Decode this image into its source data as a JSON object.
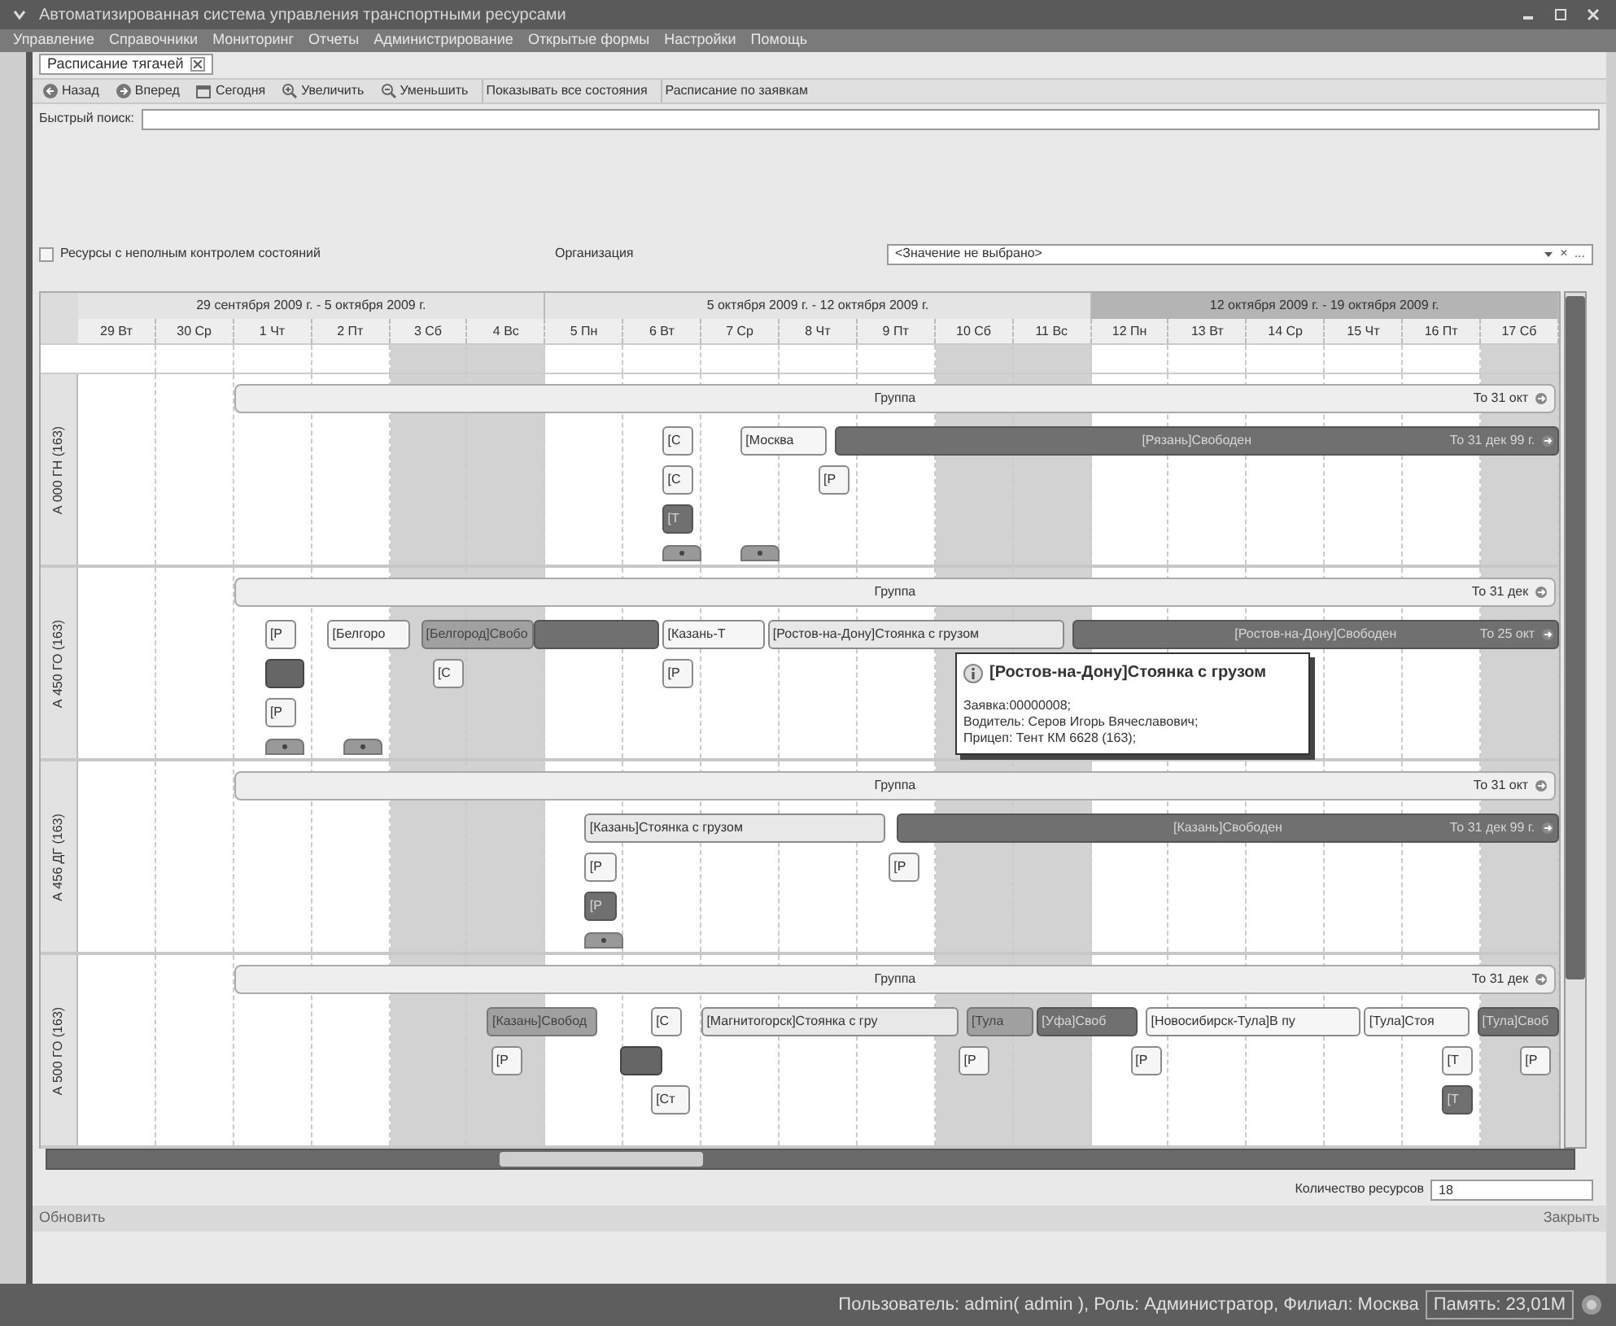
{
  "window": {
    "title": "Автоматизированная система управления транспортными ресурсами"
  },
  "menu": [
    "Управление",
    "Справочники",
    "Мониторинг",
    "Отчеты",
    "Администрирование",
    "Открытые формы",
    "Настройки",
    "Помощь"
  ],
  "tabs": [
    {
      "label": "Расписание тягачей",
      "selected": true
    }
  ],
  "toolbar": [
    {
      "kind": "back",
      "label": "Назад"
    },
    {
      "kind": "forward",
      "label": "Вперед"
    },
    {
      "kind": "today",
      "label": "Сегодня"
    },
    {
      "kind": "zoom_in",
      "label": "Увеличить"
    },
    {
      "kind": "zoom_out",
      "label": "Уменьшить"
    },
    {
      "kind": "text",
      "label": "Показывать все состояния"
    },
    {
      "kind": "text",
      "label": "Расписание по заявкам"
    }
  ],
  "quick_search": {
    "label": "Быстрый поиск:"
  },
  "filters": {
    "checkbox": {
      "label": "Ресурсы с неполным контролем состояний",
      "checked": false
    },
    "organization": {
      "label": "Организация",
      "value": "<Значение не выбрано>",
      "clear": "×",
      "more": "..."
    }
  },
  "schedule": {
    "weeks": [
      {
        "label": "29 сентября 2009 г. - 5 октября 2009 г.",
        "highlighted": false
      },
      {
        "label": "5 октября 2009 г. - 12 октября 2009 г.",
        "highlighted": false
      },
      {
        "label": "12 октября 2009 г. - 19 октября 2009 г.",
        "highlighted": true
      }
    ],
    "days": [
      {
        "label": "29 Вт",
        "weekend": false
      },
      {
        "label": "30 Ср",
        "weekend": false
      },
      {
        "label": "1 Чт",
        "weekend": false
      },
      {
        "label": "2 Пт",
        "weekend": false
      },
      {
        "label": "3 Сб",
        "weekend": true
      },
      {
        "label": "4 Вс",
        "weekend": true
      },
      {
        "label": "5 Пн",
        "weekend": false
      },
      {
        "label": "6 Вт",
        "weekend": false
      },
      {
        "label": "7 Ср",
        "weekend": false
      },
      {
        "label": "8 Чт",
        "weekend": false
      },
      {
        "label": "9 Пт",
        "weekend": false
      },
      {
        "label": "10 Сб",
        "weekend": true
      },
      {
        "label": "11 Вс",
        "weekend": true
      },
      {
        "label": "12 Пн",
        "weekend": false
      },
      {
        "label": "13 Вт",
        "weekend": false
      },
      {
        "label": "14 Ср",
        "weekend": false
      },
      {
        "label": "15 Чт",
        "weekend": false
      },
      {
        "label": "16 Пт",
        "weekend": false
      },
      {
        "label": "17 Сб",
        "weekend": true
      }
    ],
    "resources": [
      {
        "name": "А 000 ГН (163)",
        "group": {
          "label": "Группа",
          "until": "То 31 окт"
        },
        "events": [
          {
            "kind": "chip",
            "label": "[С"
          },
          {
            "kind": "chip",
            "label": "[Москва"
          },
          {
            "kind": "dark",
            "label": "[Рязань]Свободен",
            "until": "То 31 дек 99 г."
          },
          {
            "kind": "chip",
            "label": "[С"
          },
          {
            "kind": "chip",
            "label": "[Р"
          },
          {
            "kind": "dark",
            "label": "[Т"
          },
          {
            "kind": "tab"
          },
          {
            "kind": "tab"
          }
        ]
      },
      {
        "name": "А 450 ГО (163)",
        "group": {
          "label": "Группа",
          "until": "То 31 дек"
        },
        "events": [
          {
            "kind": "chip",
            "label": "[Р"
          },
          {
            "kind": "chip",
            "label": "[Белгоро"
          },
          {
            "kind": "mid",
            "label": "[Белгород]Свобо"
          },
          {
            "kind": "dark"
          },
          {
            "kind": "chip",
            "label": "[Казань-Т"
          },
          {
            "kind": "bar",
            "label": "[Ростов-на-Дону]Стоянка с грузом"
          },
          {
            "kind": "dark",
            "label": "[Ростов-на-Дону]Свободен",
            "until": "То 25 окт"
          },
          {
            "kind": "marker"
          },
          {
            "kind": "chip",
            "label": "[С"
          },
          {
            "kind": "chip",
            "label": "[Р"
          },
          {
            "kind": "chip",
            "label": "[Р"
          },
          {
            "kind": "tab"
          },
          {
            "kind": "tab"
          }
        ]
      },
      {
        "name": "А 456 ДГ (163)",
        "group": {
          "label": "Группа",
          "until": "То 31 окт"
        },
        "events": [
          {
            "kind": "bar",
            "label": "[Казань]Стоянка с грузом"
          },
          {
            "kind": "dark",
            "label": "[Казань]Свободен",
            "until": "То 31 дек 99 г."
          },
          {
            "kind": "chip",
            "label": "[Р"
          },
          {
            "kind": "chip",
            "label": "[Р"
          },
          {
            "kind": "dark",
            "label": "[Р"
          },
          {
            "kind": "tab"
          }
        ]
      },
      {
        "name": "А 500 ГО (163)",
        "group": {
          "label": "Группа",
          "until": "То 31 дек"
        },
        "events": [
          {
            "kind": "mid",
            "label": "[Казань]Свобод"
          },
          {
            "kind": "chip",
            "label": "[С"
          },
          {
            "kind": "bar",
            "label": "[Магнитогорск]Стоянка с гру"
          },
          {
            "kind": "mid",
            "label": "[Тула"
          },
          {
            "kind": "dark",
            "label": "[Уфа]Своб"
          },
          {
            "kind": "chip",
            "label": "[Новосибирск-Тула]В пу"
          },
          {
            "kind": "chip",
            "label": "[Тула]Стоя"
          },
          {
            "kind": "dark",
            "label": "[Тула]Своб"
          },
          {
            "kind": "chip",
            "label": "[Р"
          },
          {
            "kind": "marker"
          },
          {
            "kind": "chip",
            "label": "[Р"
          },
          {
            "kind": "chip",
            "label": "[Р"
          },
          {
            "kind": "chip",
            "label": "[Т"
          },
          {
            "kind": "chip",
            "label": "[Р"
          },
          {
            "kind": "chip",
            "label": "[Ст"
          },
          {
            "kind": "dark",
            "label": "[Т"
          }
        ]
      }
    ]
  },
  "tooltip": {
    "title": "[Ростов-на-Дону]Стоянка с грузом",
    "lines": [
      "Заявка:00000008;",
      "Водитель: Серов Игорь Вячеславович;",
      "Прицеп: Тент КМ 6628 (163);"
    ]
  },
  "resource_count": {
    "label": "Количество ресурсов",
    "value": "18"
  },
  "footer": {
    "refresh": "Обновить",
    "close": "Закрыть"
  },
  "status_bar": {
    "user": "Пользователь: admin( admin ), Роль: Администратор, Филиал: Москва",
    "memory": "Память: 23,01М"
  }
}
